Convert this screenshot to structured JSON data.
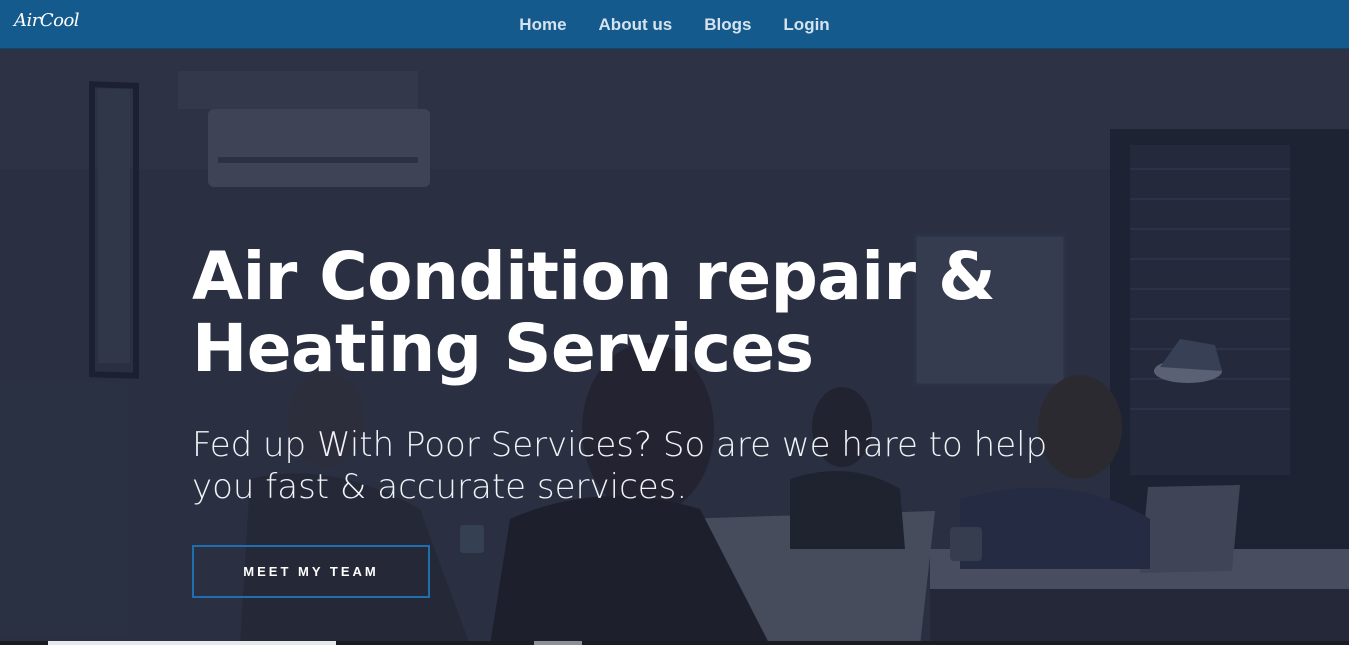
{
  "header": {
    "logo": "AirCool",
    "nav": [
      {
        "label": "Home"
      },
      {
        "label": "About us"
      },
      {
        "label": "Blogs"
      },
      {
        "label": "Login"
      }
    ]
  },
  "hero": {
    "title_line1": "Air Condition repair &",
    "title_line2": "Heating Services",
    "subtitle_line1": "Fed up With Poor Services? So are we hare to help",
    "subtitle_line2": "you fast & accurate services.",
    "cta_label": "MEET MY TEAM"
  },
  "colors": {
    "navbar": "#145a8c",
    "cta_border": "#1f6fb0",
    "text": "#ffffff"
  }
}
